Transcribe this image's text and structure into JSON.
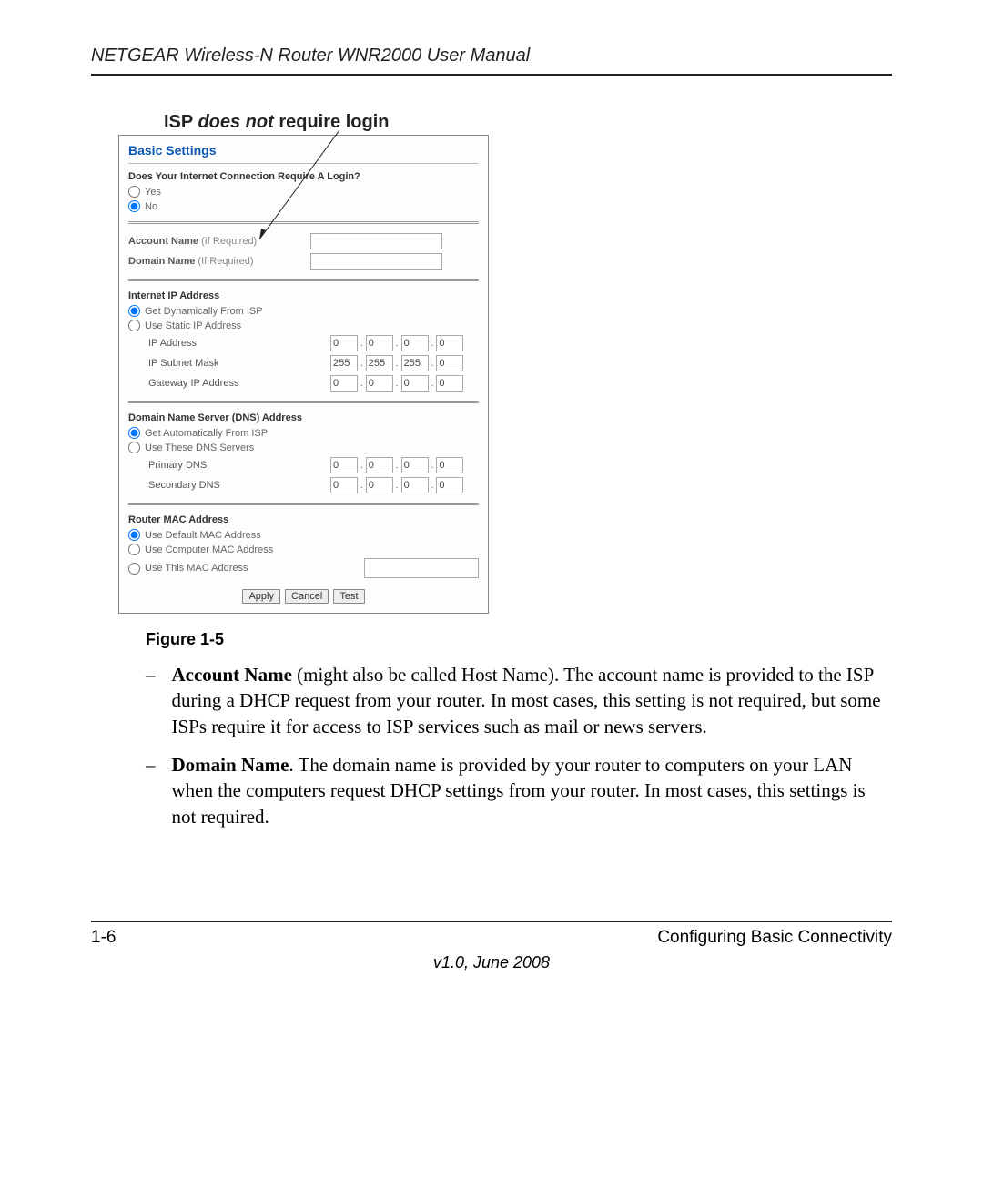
{
  "header": "NETGEAR Wireless-N Router WNR2000 User Manual",
  "callout_prefix": "ISP ",
  "callout_emph": "does not",
  "callout_suffix": " require login",
  "panel": {
    "title": "Basic Settings",
    "login_q": "Does Your Internet Connection Require A Login?",
    "yes": "Yes",
    "no": "No",
    "account_label": "Account Name",
    "if_required": " (If Required)",
    "domain_label": "Domain Name",
    "ipsec": {
      "title": "Internet IP Address",
      "dyn": "Get Dynamically From ISP",
      "static": "Use Static IP Address",
      "ip_label": "IP Address",
      "mask_label": "IP Subnet Mask",
      "gw_label": "Gateway IP Address",
      "ip": [
        "0",
        "0",
        "0",
        "0"
      ],
      "mask": [
        "255",
        "255",
        "255",
        "0"
      ],
      "gw": [
        "0",
        "0",
        "0",
        "0"
      ]
    },
    "dns": {
      "title": "Domain Name Server (DNS) Address",
      "auto": "Get Automatically From ISP",
      "use": "Use These DNS Servers",
      "primary_label": "Primary DNS",
      "secondary_label": "Secondary DNS",
      "primary": [
        "0",
        "0",
        "0",
        "0"
      ],
      "secondary": [
        "0",
        "0",
        "0",
        "0"
      ]
    },
    "mac": {
      "title": "Router MAC Address",
      "default": "Use Default MAC Address",
      "computer": "Use Computer MAC Address",
      "this": "Use This MAC Address"
    },
    "buttons": {
      "apply": "Apply",
      "cancel": "Cancel",
      "test": "Test"
    }
  },
  "figure_caption": "Figure 1-5",
  "list": {
    "item1_bold": "Account Name",
    "item1_rest": " (might also be called Host Name). The account name is provided to the ISP during a DHCP request from your router. In most cases, this setting is not required, but some ISPs require it for access to ISP services such as mail or news servers.",
    "item2_bold": "Domain Name",
    "item2_rest": ". The domain name is provided by your router to computers on your LAN when the computers request DHCP settings from your router. In most cases, this settings is not required."
  },
  "footer": {
    "left": "1-6",
    "right": "Configuring Basic Connectivity",
    "center": "v1.0, June 2008"
  }
}
